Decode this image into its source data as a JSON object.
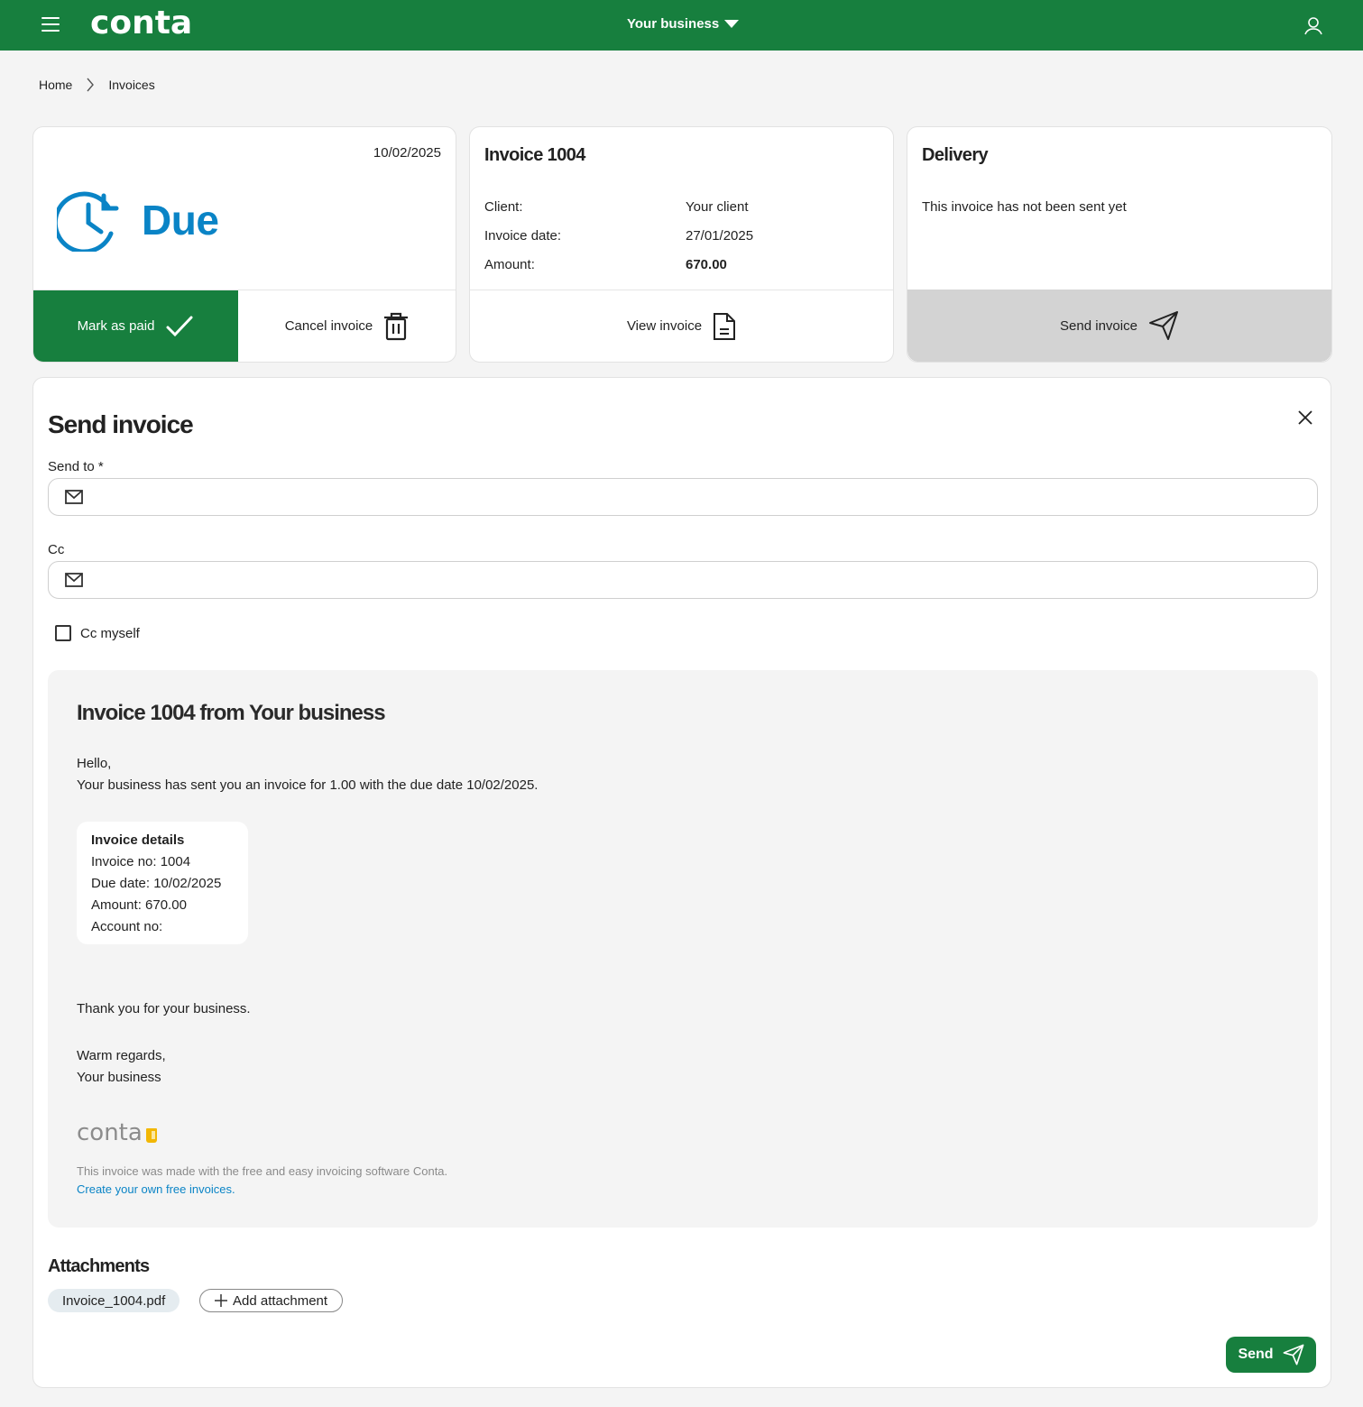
{
  "topbar": {
    "logo": "conta",
    "business_select": "Your business",
    "icons": {
      "menu": "hamburger-icon",
      "dropdown": "caret-down-icon",
      "user": "user-icon"
    }
  },
  "breadcrumb": {
    "items": [
      "Home",
      "Invoices"
    ],
    "separator_icon": "chevron-right-icon"
  },
  "status_card": {
    "due_date": "10/02/2025",
    "status": "Due",
    "status_icon": "clock-refresh-icon",
    "status_color": "#0a84c6",
    "mark_paid_label": "Mark as paid",
    "mark_paid_icon": "check-icon",
    "cancel_label": "Cancel invoice",
    "cancel_icon": "trash-icon"
  },
  "invoice_card": {
    "title": "Invoice 1004",
    "rows": [
      {
        "label": "Client:",
        "value": "Your client"
      },
      {
        "label": "Invoice date:",
        "value": "27/01/2025"
      },
      {
        "label": "Amount:",
        "value": "670.00"
      }
    ],
    "view_label": "View invoice",
    "view_icon": "document-icon"
  },
  "delivery_card": {
    "title": "Delivery",
    "message": "This invoice has not been sent yet",
    "send_label": "Send invoice",
    "send_icon": "paper-plane-icon"
  },
  "send_panel": {
    "title": "Send invoice",
    "close_icon": "close-icon",
    "send_to_label": "Send to *",
    "send_to_value": "",
    "cc_label": "Cc",
    "cc_value": "",
    "field_icon": "envelope-icon",
    "cc_myself_label": "Cc myself",
    "cc_myself_checked": false,
    "preview": {
      "heading": "Invoice 1004 from Your business",
      "greeting": "Hello,",
      "body": "Your business has sent you an invoice for 1.00 with the due date 10/02/2025.",
      "details": {
        "title": "Invoice details",
        "invoice_no": "Invoice no: 1004",
        "due_date": "Due date: 10/02/2025",
        "amount": "Amount: 670.00",
        "account_no": "Account no:"
      },
      "thanks": "Thank you for your business.",
      "regards": "Warm regards,",
      "signature": "Your business",
      "footer_logo": "conta",
      "powered_by": "This invoice was made with the free and easy invoicing software Conta.",
      "create_link": "Create your own free invoices."
    },
    "attachments_title": "Attachments",
    "attachments": [
      "Invoice_1004.pdf"
    ],
    "add_attachment_label": "Add attachment",
    "send_label": "Send"
  },
  "colors": {
    "brand_green": "#177f3e",
    "status_blue": "#0a84c6",
    "link_blue": "#0a84c6"
  }
}
